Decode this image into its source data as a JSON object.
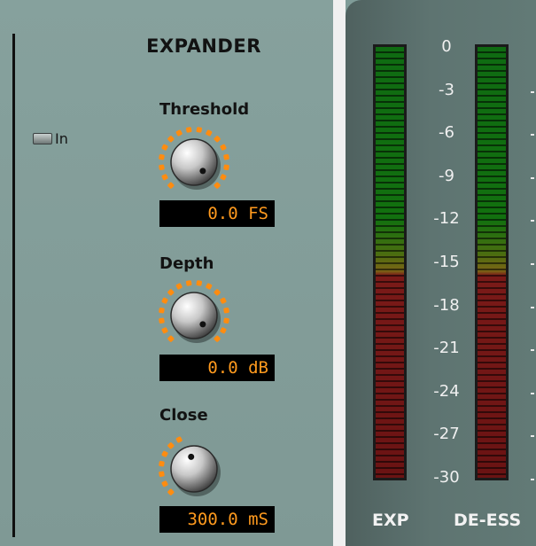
{
  "expander": {
    "title": "EXPANDER",
    "in_toggle": {
      "label": "In",
      "on": false
    },
    "controls": [
      {
        "id": "threshold",
        "label": "Threshold",
        "readout": "0.0 FS",
        "knob_level": 1.0
      },
      {
        "id": "depth",
        "label": "Depth",
        "readout": "0.0 dB",
        "knob_level": 1.0
      },
      {
        "id": "close",
        "label": "Close",
        "readout": "300.0 mS",
        "knob_level": 0.45
      }
    ]
  },
  "meters": {
    "scale": [
      "0",
      "-3",
      "-6",
      "-9",
      "-12",
      "-15",
      "-18",
      "-21",
      "-24",
      "-27",
      "-30"
    ],
    "channels": [
      {
        "id": "exp",
        "label": "EXP"
      },
      {
        "id": "de-ess",
        "label": "DE-ESS"
      }
    ]
  },
  "colors": {
    "readout_text": "#ff9a1e",
    "knob_arc": "#ff8c10",
    "meter_green": "#12700f",
    "meter_red": "#7a1a18"
  }
}
